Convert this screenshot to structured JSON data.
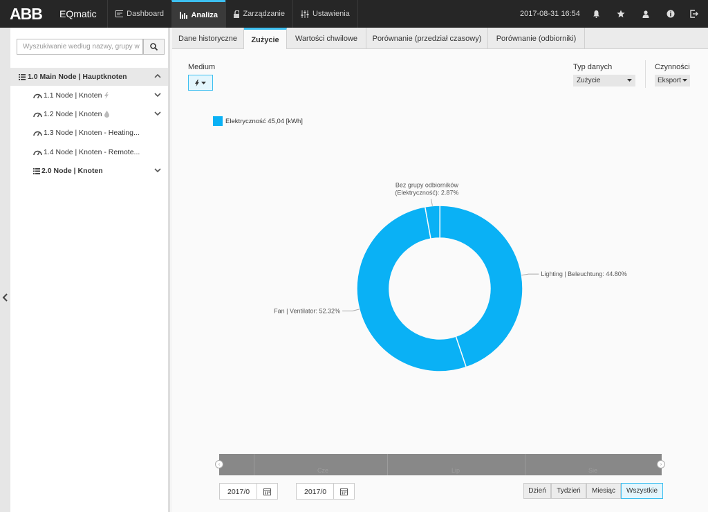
{
  "brand": {
    "logo": "ABB",
    "app_name": "EQmatic",
    "accent": "#3dbff0"
  },
  "nav": [
    {
      "label": "Dashboard",
      "icon": "dashboard-icon"
    },
    {
      "label": "Analiza",
      "icon": "bar-chart-icon",
      "active": true
    },
    {
      "label": "Zarządzanie",
      "icon": "lock-icon"
    },
    {
      "label": "Ustawienia",
      "icon": "sliders-icon"
    }
  ],
  "datetime": "2017-08-31 16:54",
  "top_icons": [
    "bell-icon",
    "star-icon",
    "user-icon",
    "info-icon",
    "logout-icon"
  ],
  "sidebar": {
    "search_placeholder": "Wyszukiwanie według nazwy, grupy w",
    "tree": [
      {
        "label": "1.0 Main Node | Hauptknoten",
        "icon": "list-icon",
        "expand": "chevron-up-icon"
      },
      {
        "label": "1.1 Node | Knoten",
        "icon": "gauge-icon",
        "extra_icon": "lightning-icon",
        "expand": "chevron-down-icon"
      },
      {
        "label": "1.2 Node | Knoten",
        "icon": "gauge-icon",
        "extra_icon": "drop-icon",
        "expand": "chevron-down-icon"
      },
      {
        "label": "1.3 Node | Knoten - Heating...",
        "icon": "gauge-icon"
      },
      {
        "label": "1.4 Node | Knoten - Remote...",
        "icon": "gauge-icon"
      },
      {
        "label": "2.0 Node | Knoten",
        "icon": "list-icon",
        "expand": "chevron-down-icon"
      }
    ]
  },
  "tabs": [
    {
      "label": "Dane historyczne"
    },
    {
      "label": "Zużycie",
      "active": true
    },
    {
      "label": "Wartości chwilowe"
    },
    {
      "label": "Porównanie (przedział czasowy)"
    },
    {
      "label": "Porównanie (odbiorniki)"
    }
  ],
  "controls": {
    "medium_label": "Medium",
    "data_type_label": "Typ danych",
    "data_type_value": "Zużycie",
    "actions_label": "Czynności",
    "export_label": "Eksport"
  },
  "legend": {
    "name": "Elektryczność",
    "value": "45,04 [kWh]",
    "color": "#0ab1f5"
  },
  "chart_data": {
    "type": "pie",
    "donut": true,
    "color": "#0ab1f5",
    "slices": [
      {
        "label": "Lighting | Beleuchtung",
        "value": 44.8,
        "display": "Lighting | Beleuchtung: 44.80%"
      },
      {
        "label": "Fan | Ventilator",
        "value": 52.32,
        "display": "Fan | Ventilator: 52.32%"
      },
      {
        "label": "Bez grupy odbiorników (Elektryczność)",
        "value": 2.87,
        "display_lines": [
          "Bez grupy odbiorników",
          "(Elektryczność): 2.87%"
        ]
      }
    ]
  },
  "timeline": {
    "labels": [
      "Cze",
      "Lip",
      "Sie"
    ]
  },
  "date_from": "2017/0",
  "date_to": "2017/0",
  "range_buttons": [
    {
      "label": "Dzień"
    },
    {
      "label": "Tydzień"
    },
    {
      "label": "Miesiąc"
    },
    {
      "label": "Wszystkie",
      "active": true
    }
  ]
}
